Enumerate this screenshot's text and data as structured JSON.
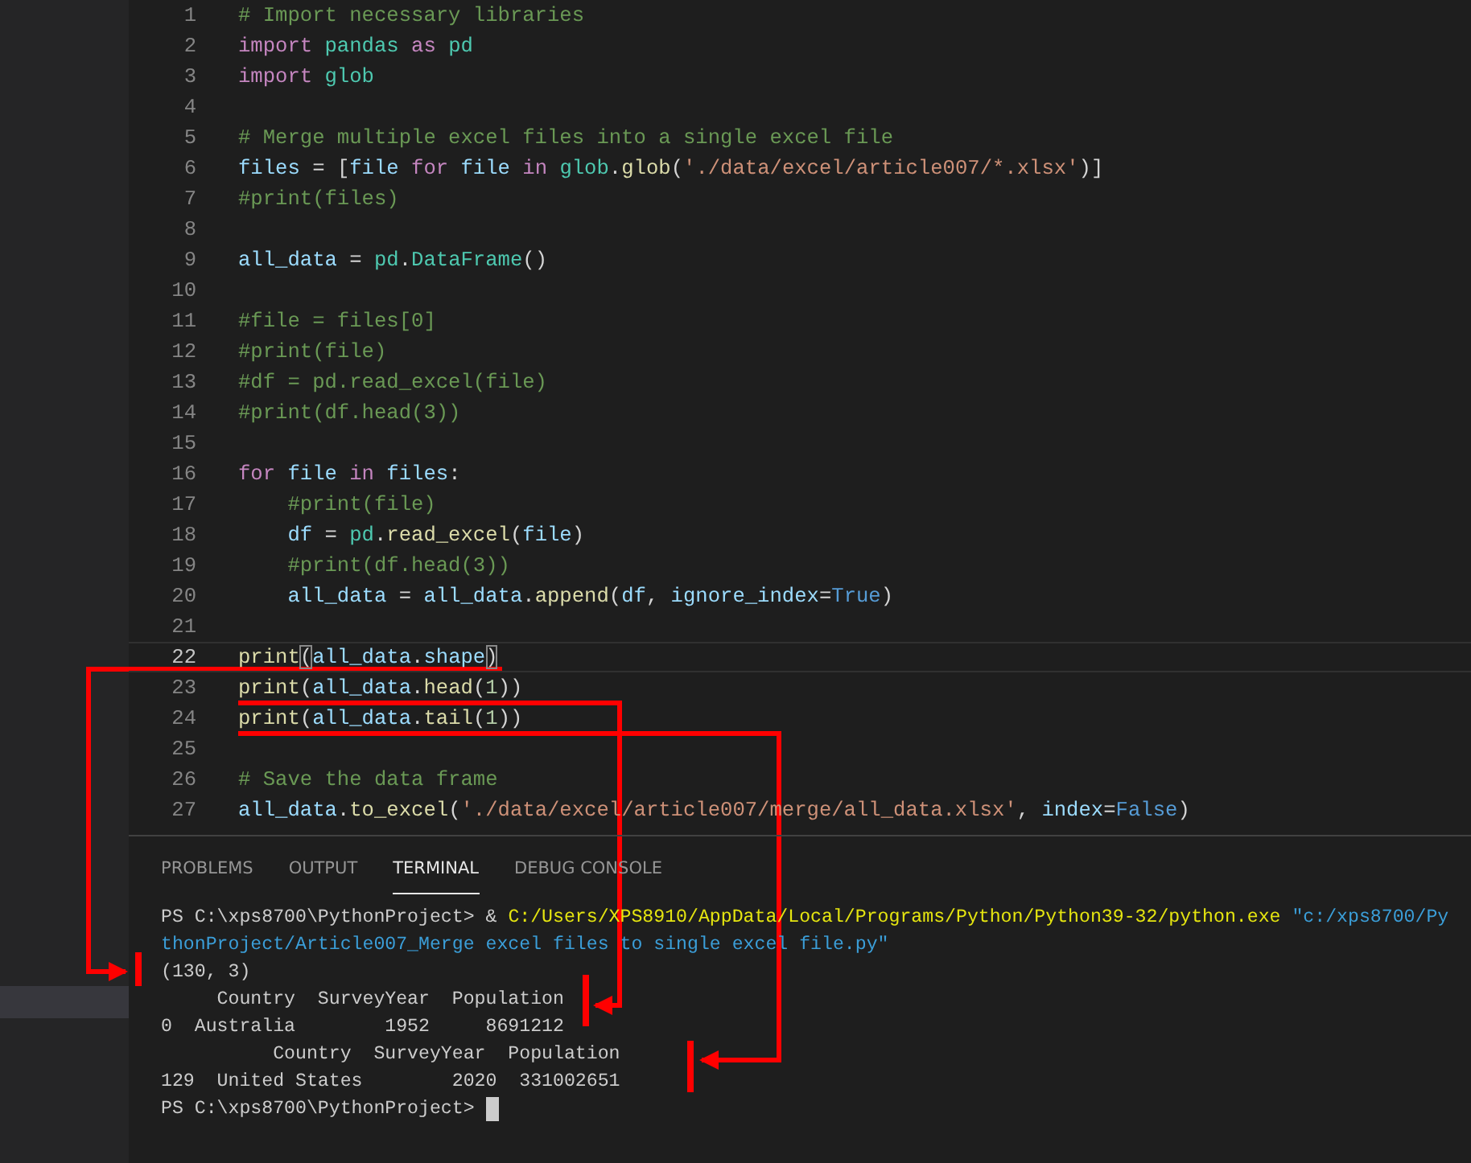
{
  "sidebar": {
    "highlighted_row": true
  },
  "editor": {
    "lines": [
      {
        "number": "1",
        "current": false,
        "indent": false,
        "tokens": [
          {
            "kind": "comment",
            "text": "# Import necessary libraries"
          }
        ]
      },
      {
        "number": "2",
        "current": false,
        "indent": false,
        "tokens": [
          {
            "kind": "keyword",
            "text": "import"
          },
          {
            "kind": "module",
            "text": " pandas"
          },
          {
            "kind": "keyword",
            "text": " as"
          },
          {
            "kind": "module",
            "text": " pd"
          }
        ]
      },
      {
        "number": "3",
        "current": false,
        "indent": false,
        "tokens": [
          {
            "kind": "keyword",
            "text": "import"
          },
          {
            "kind": "module",
            "text": " glob"
          }
        ]
      },
      {
        "number": "4",
        "current": false
      },
      {
        "number": "5",
        "current": false,
        "indent": false,
        "tokens": [
          {
            "kind": "comment",
            "text": "# Merge multiple excel files into a single excel file"
          }
        ]
      },
      {
        "number": "6",
        "current": false,
        "indent": false,
        "tokens": [
          {
            "kind": "variable",
            "text": "files"
          },
          {
            "kind": "plain",
            "text": " = ["
          },
          {
            "kind": "variable",
            "text": "file"
          },
          {
            "kind": "keyword",
            "text": " for"
          },
          {
            "kind": "variable",
            "text": " file"
          },
          {
            "kind": "keyword",
            "text": " in"
          },
          {
            "kind": "module",
            "text": " glob"
          },
          {
            "kind": "plain",
            "text": "."
          },
          {
            "kind": "function",
            "text": "glob"
          },
          {
            "kind": "plain",
            "text": "("
          },
          {
            "kind": "string",
            "text": "'./data/excel/article007/*.xlsx'"
          },
          {
            "kind": "plain",
            "text": ")]"
          }
        ]
      },
      {
        "number": "7",
        "current": false,
        "indent": false,
        "tokens": [
          {
            "kind": "comment",
            "text": "#print(files)"
          }
        ]
      },
      {
        "number": "8",
        "current": false
      },
      {
        "number": "9",
        "current": false,
        "indent": false,
        "tokens": [
          {
            "kind": "variable",
            "text": "all_data"
          },
          {
            "kind": "plain",
            "text": " = "
          },
          {
            "kind": "module",
            "text": "pd"
          },
          {
            "kind": "plain",
            "text": "."
          },
          {
            "kind": "class",
            "text": "DataFrame"
          },
          {
            "kind": "plain",
            "text": "()"
          }
        ]
      },
      {
        "number": "10",
        "current": false
      },
      {
        "number": "11",
        "current": false,
        "indent": false,
        "tokens": [
          {
            "kind": "comment",
            "text": "#file = files[0]"
          }
        ]
      },
      {
        "number": "12",
        "current": false,
        "indent": false,
        "tokens": [
          {
            "kind": "comment",
            "text": "#print(file)"
          }
        ]
      },
      {
        "number": "13",
        "current": false,
        "indent": false,
        "tokens": [
          {
            "kind": "comment",
            "text": "#df = pd.read_excel(file)"
          }
        ]
      },
      {
        "number": "14",
        "current": false,
        "indent": false,
        "tokens": [
          {
            "kind": "comment",
            "text": "#print(df.head(3))"
          }
        ]
      },
      {
        "number": "15",
        "current": false
      },
      {
        "number": "16",
        "current": false,
        "indent": false,
        "tokens": [
          {
            "kind": "keyword",
            "text": "for"
          },
          {
            "kind": "variable",
            "text": " file"
          },
          {
            "kind": "keyword",
            "text": " in"
          },
          {
            "kind": "variable",
            "text": " files"
          },
          {
            "kind": "plain",
            "text": ":"
          }
        ]
      },
      {
        "number": "17",
        "current": false,
        "indent": true,
        "tokens": [
          {
            "kind": "comment",
            "text": "#print(file)"
          }
        ]
      },
      {
        "number": "18",
        "current": false,
        "indent": true,
        "tokens": [
          {
            "kind": "variable",
            "text": "df"
          },
          {
            "kind": "plain",
            "text": " = "
          },
          {
            "kind": "module",
            "text": "pd"
          },
          {
            "kind": "plain",
            "text": "."
          },
          {
            "kind": "function",
            "text": "read_excel"
          },
          {
            "kind": "plain",
            "text": "("
          },
          {
            "kind": "variable",
            "text": "file"
          },
          {
            "kind": "plain",
            "text": ")"
          }
        ]
      },
      {
        "number": "19",
        "current": false,
        "indent": true,
        "tokens": [
          {
            "kind": "comment",
            "text": "#print(df.head(3))"
          }
        ]
      },
      {
        "number": "20",
        "current": false,
        "indent": true,
        "tokens": [
          {
            "kind": "variable",
            "text": "all_data"
          },
          {
            "kind": "plain",
            "text": " = "
          },
          {
            "kind": "variable",
            "text": "all_data"
          },
          {
            "kind": "plain",
            "text": "."
          },
          {
            "kind": "function",
            "text": "append"
          },
          {
            "kind": "plain",
            "text": "("
          },
          {
            "kind": "variable",
            "text": "df"
          },
          {
            "kind": "plain",
            "text": ", "
          },
          {
            "kind": "variable",
            "text": "ignore_index"
          },
          {
            "kind": "plain",
            "text": "="
          },
          {
            "kind": "constant",
            "text": "True"
          },
          {
            "kind": "plain",
            "text": ")"
          }
        ]
      },
      {
        "number": "21",
        "current": false
      },
      {
        "number": "22",
        "current": true,
        "indent": false,
        "tokens": [
          {
            "kind": "function",
            "text": "print"
          },
          {
            "kind": "bracket",
            "text": "("
          },
          {
            "kind": "variable",
            "text": "all_data"
          },
          {
            "kind": "plain",
            "text": "."
          },
          {
            "kind": "variable",
            "text": "shape"
          },
          {
            "kind": "bracket",
            "text": ")"
          }
        ]
      },
      {
        "number": "23",
        "current": false,
        "indent": false,
        "tokens": [
          {
            "kind": "function",
            "text": "print"
          },
          {
            "kind": "plain",
            "text": "("
          },
          {
            "kind": "variable",
            "text": "all_data"
          },
          {
            "kind": "plain",
            "text": "."
          },
          {
            "kind": "function",
            "text": "head"
          },
          {
            "kind": "plain",
            "text": "("
          },
          {
            "kind": "number",
            "text": "1"
          },
          {
            "kind": "plain",
            "text": "))"
          }
        ]
      },
      {
        "number": "24",
        "current": false,
        "indent": false,
        "tokens": [
          {
            "kind": "function",
            "text": "print"
          },
          {
            "kind": "plain",
            "text": "("
          },
          {
            "kind": "variable",
            "text": "all_data"
          },
          {
            "kind": "plain",
            "text": "."
          },
          {
            "kind": "function",
            "text": "tail"
          },
          {
            "kind": "plain",
            "text": "("
          },
          {
            "kind": "number",
            "text": "1"
          },
          {
            "kind": "plain",
            "text": "))"
          }
        ]
      },
      {
        "number": "25",
        "current": false
      },
      {
        "number": "26",
        "current": false,
        "indent": false,
        "tokens": [
          {
            "kind": "comment",
            "text": "# Save the data frame"
          }
        ]
      },
      {
        "number": "27",
        "current": false,
        "indent": false,
        "tokens": [
          {
            "kind": "variable",
            "text": "all_data"
          },
          {
            "kind": "plain",
            "text": "."
          },
          {
            "kind": "function",
            "text": "to_excel"
          },
          {
            "kind": "plain",
            "text": "("
          },
          {
            "kind": "string",
            "text": "'./data/excel/article007/merge/all_data.xlsx'"
          },
          {
            "kind": "plain",
            "text": ", "
          },
          {
            "kind": "variable",
            "text": "index"
          },
          {
            "kind": "plain",
            "text": "="
          },
          {
            "kind": "constant",
            "text": "False"
          },
          {
            "kind": "plain",
            "text": ")"
          }
        ]
      }
    ]
  },
  "panel": {
    "tabs": [
      {
        "label": "PROBLEMS",
        "selected": false
      },
      {
        "label": "OUTPUT",
        "selected": false
      },
      {
        "label": "TERMINAL",
        "selected": true
      },
      {
        "label": "DEBUG CONSOLE",
        "selected": false
      }
    ],
    "terminal_lines": [
      {
        "cursor": false,
        "tokens": [
          {
            "kind": "plain",
            "text": "PS C:\\xps8700\\PythonProject> & "
          },
          {
            "kind": "path",
            "text": "C:/Users/XPS8910/AppData/Local/Programs/Python/Python39-32/python.exe"
          },
          {
            "kind": "string",
            "text": " \"c:/xps8700/Py"
          }
        ]
      },
      {
        "cursor": false,
        "tokens": [
          {
            "kind": "string",
            "text": "thonProject/Article007_Merge excel files to single excel file.py\""
          }
        ]
      },
      {
        "cursor": false,
        "tokens": [
          {
            "kind": "plain",
            "text": "(130, 3)"
          }
        ]
      },
      {
        "cursor": false,
        "tokens": [
          {
            "kind": "plain",
            "text": "     Country  SurveyYear  Population"
          }
        ]
      },
      {
        "cursor": false,
        "tokens": [
          {
            "kind": "plain",
            "text": "0  Australia        1952     8691212"
          }
        ]
      },
      {
        "cursor": false,
        "tokens": [
          {
            "kind": "plain",
            "text": "          Country  SurveyYear  Population"
          }
        ]
      },
      {
        "cursor": false,
        "tokens": [
          {
            "kind": "plain",
            "text": "129  United States        2020  331002651"
          }
        ]
      },
      {
        "cursor": true,
        "tokens": [
          {
            "kind": "plain",
            "text": "PS C:\\xps8700\\PythonProject> "
          }
        ]
      }
    ]
  }
}
